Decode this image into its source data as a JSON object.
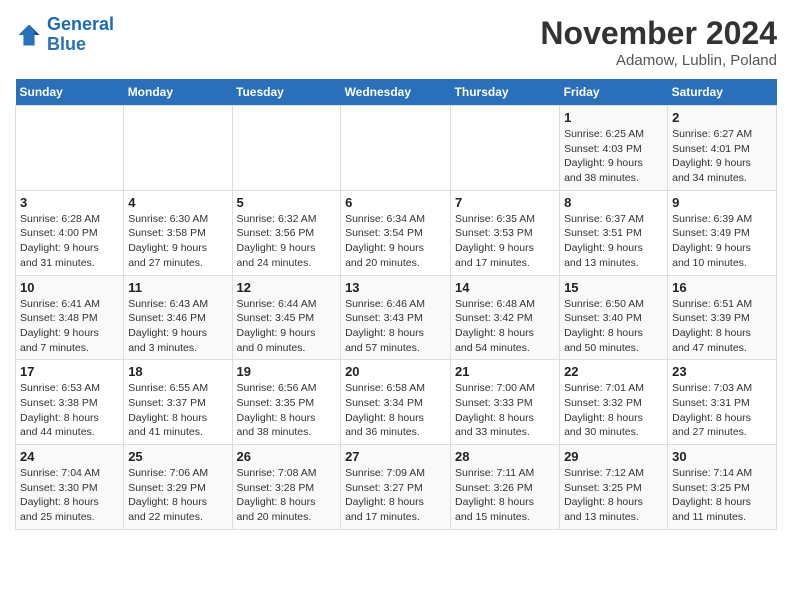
{
  "header": {
    "logo_line1": "General",
    "logo_line2": "Blue",
    "month": "November 2024",
    "location": "Adamow, Lublin, Poland"
  },
  "weekdays": [
    "Sunday",
    "Monday",
    "Tuesday",
    "Wednesday",
    "Thursday",
    "Friday",
    "Saturday"
  ],
  "weeks": [
    [
      {
        "day": "",
        "info": ""
      },
      {
        "day": "",
        "info": ""
      },
      {
        "day": "",
        "info": ""
      },
      {
        "day": "",
        "info": ""
      },
      {
        "day": "",
        "info": ""
      },
      {
        "day": "1",
        "info": "Sunrise: 6:25 AM\nSunset: 4:03 PM\nDaylight: 9 hours\nand 38 minutes."
      },
      {
        "day": "2",
        "info": "Sunrise: 6:27 AM\nSunset: 4:01 PM\nDaylight: 9 hours\nand 34 minutes."
      }
    ],
    [
      {
        "day": "3",
        "info": "Sunrise: 6:28 AM\nSunset: 4:00 PM\nDaylight: 9 hours\nand 31 minutes."
      },
      {
        "day": "4",
        "info": "Sunrise: 6:30 AM\nSunset: 3:58 PM\nDaylight: 9 hours\nand 27 minutes."
      },
      {
        "day": "5",
        "info": "Sunrise: 6:32 AM\nSunset: 3:56 PM\nDaylight: 9 hours\nand 24 minutes."
      },
      {
        "day": "6",
        "info": "Sunrise: 6:34 AM\nSunset: 3:54 PM\nDaylight: 9 hours\nand 20 minutes."
      },
      {
        "day": "7",
        "info": "Sunrise: 6:35 AM\nSunset: 3:53 PM\nDaylight: 9 hours\nand 17 minutes."
      },
      {
        "day": "8",
        "info": "Sunrise: 6:37 AM\nSunset: 3:51 PM\nDaylight: 9 hours\nand 13 minutes."
      },
      {
        "day": "9",
        "info": "Sunrise: 6:39 AM\nSunset: 3:49 PM\nDaylight: 9 hours\nand 10 minutes."
      }
    ],
    [
      {
        "day": "10",
        "info": "Sunrise: 6:41 AM\nSunset: 3:48 PM\nDaylight: 9 hours\nand 7 minutes."
      },
      {
        "day": "11",
        "info": "Sunrise: 6:43 AM\nSunset: 3:46 PM\nDaylight: 9 hours\nand 3 minutes."
      },
      {
        "day": "12",
        "info": "Sunrise: 6:44 AM\nSunset: 3:45 PM\nDaylight: 9 hours\nand 0 minutes."
      },
      {
        "day": "13",
        "info": "Sunrise: 6:46 AM\nSunset: 3:43 PM\nDaylight: 8 hours\nand 57 minutes."
      },
      {
        "day": "14",
        "info": "Sunrise: 6:48 AM\nSunset: 3:42 PM\nDaylight: 8 hours\nand 54 minutes."
      },
      {
        "day": "15",
        "info": "Sunrise: 6:50 AM\nSunset: 3:40 PM\nDaylight: 8 hours\nand 50 minutes."
      },
      {
        "day": "16",
        "info": "Sunrise: 6:51 AM\nSunset: 3:39 PM\nDaylight: 8 hours\nand 47 minutes."
      }
    ],
    [
      {
        "day": "17",
        "info": "Sunrise: 6:53 AM\nSunset: 3:38 PM\nDaylight: 8 hours\nand 44 minutes."
      },
      {
        "day": "18",
        "info": "Sunrise: 6:55 AM\nSunset: 3:37 PM\nDaylight: 8 hours\nand 41 minutes."
      },
      {
        "day": "19",
        "info": "Sunrise: 6:56 AM\nSunset: 3:35 PM\nDaylight: 8 hours\nand 38 minutes."
      },
      {
        "day": "20",
        "info": "Sunrise: 6:58 AM\nSunset: 3:34 PM\nDaylight: 8 hours\nand 36 minutes."
      },
      {
        "day": "21",
        "info": "Sunrise: 7:00 AM\nSunset: 3:33 PM\nDaylight: 8 hours\nand 33 minutes."
      },
      {
        "day": "22",
        "info": "Sunrise: 7:01 AM\nSunset: 3:32 PM\nDaylight: 8 hours\nand 30 minutes."
      },
      {
        "day": "23",
        "info": "Sunrise: 7:03 AM\nSunset: 3:31 PM\nDaylight: 8 hours\nand 27 minutes."
      }
    ],
    [
      {
        "day": "24",
        "info": "Sunrise: 7:04 AM\nSunset: 3:30 PM\nDaylight: 8 hours\nand 25 minutes."
      },
      {
        "day": "25",
        "info": "Sunrise: 7:06 AM\nSunset: 3:29 PM\nDaylight: 8 hours\nand 22 minutes."
      },
      {
        "day": "26",
        "info": "Sunrise: 7:08 AM\nSunset: 3:28 PM\nDaylight: 8 hours\nand 20 minutes."
      },
      {
        "day": "27",
        "info": "Sunrise: 7:09 AM\nSunset: 3:27 PM\nDaylight: 8 hours\nand 17 minutes."
      },
      {
        "day": "28",
        "info": "Sunrise: 7:11 AM\nSunset: 3:26 PM\nDaylight: 8 hours\nand 15 minutes."
      },
      {
        "day": "29",
        "info": "Sunrise: 7:12 AM\nSunset: 3:25 PM\nDaylight: 8 hours\nand 13 minutes."
      },
      {
        "day": "30",
        "info": "Sunrise: 7:14 AM\nSunset: 3:25 PM\nDaylight: 8 hours\nand 11 minutes."
      }
    ]
  ]
}
